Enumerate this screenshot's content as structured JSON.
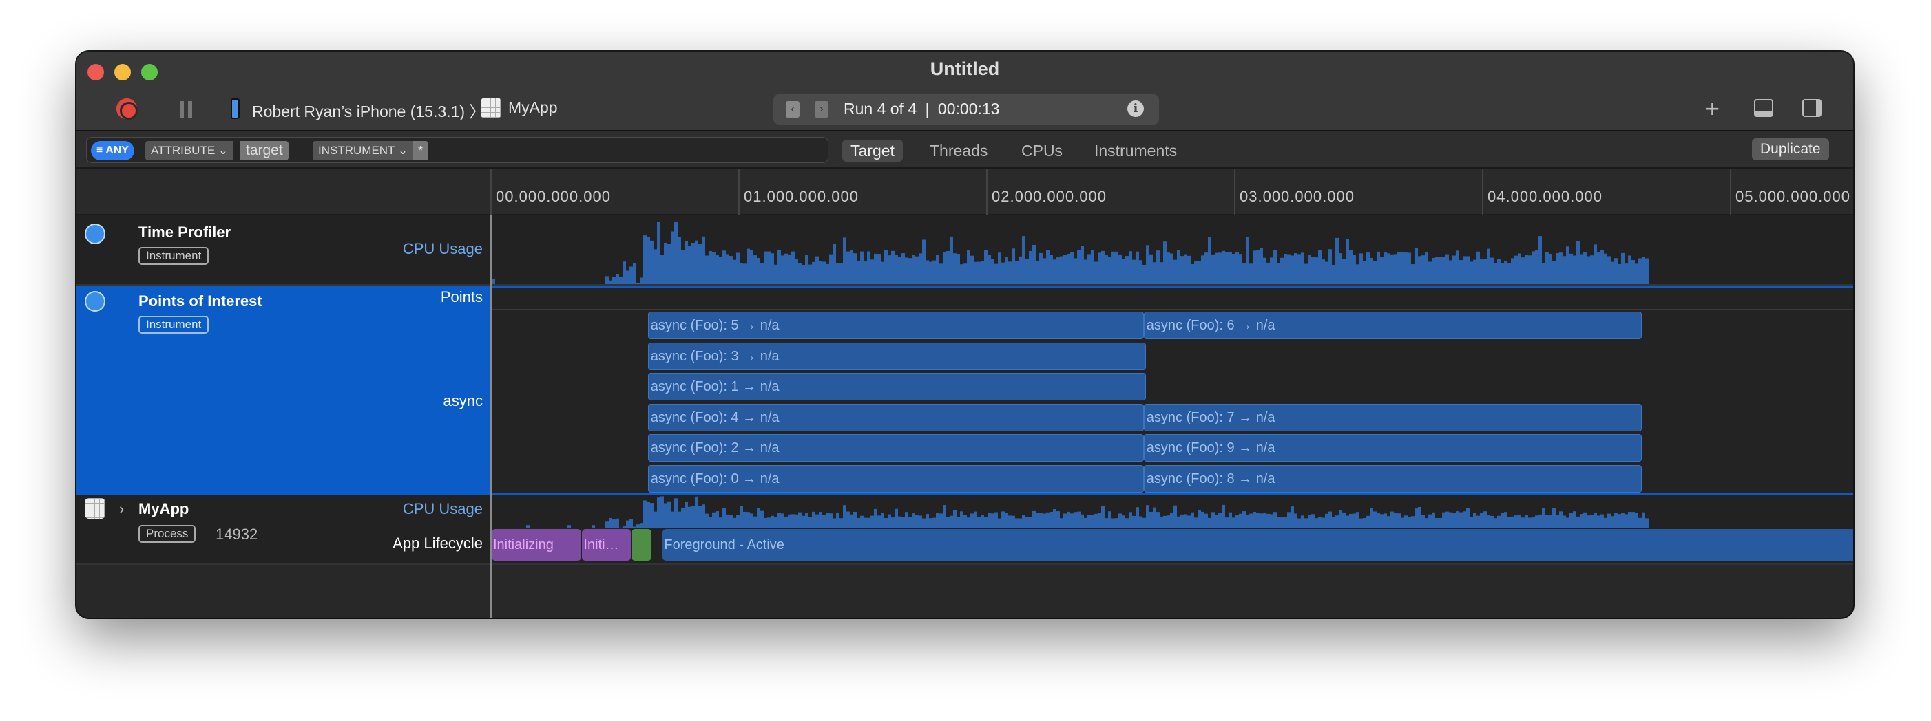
{
  "window": {
    "title": "Untitled"
  },
  "toolbar": {
    "device": "Robert Ryan’s iPhone (15.3.1)",
    "separator": "〉",
    "app": "MyApp",
    "run": "Run 4 of 4",
    "divider": "|",
    "elapsed": "00:00:13",
    "info": "i",
    "prev": "‹",
    "next": "›",
    "add": "+"
  },
  "filter": {
    "any": "ANY",
    "attribute": "ATTRIBUTE ⌄",
    "attribute_value": "target",
    "instrument": "INSTRUMENT ⌄",
    "instrument_value": "*"
  },
  "tabs": [
    "Target",
    "Threads",
    "CPUs",
    "Instruments"
  ],
  "duplicate": "Duplicate",
  "ruler": [
    "00.000.000.000",
    "01.000.000.000",
    "02.000.000.000",
    "03.000.000.000",
    "04.000.000.000",
    "05.000.000.000"
  ],
  "tracks": {
    "time_profiler": {
      "name": "Time Profiler",
      "badge": "Instrument",
      "lane": "CPU Usage"
    },
    "poi": {
      "name": "Points of Interest",
      "badge": "Instrument",
      "lane_points": "Points",
      "lane_async": "async"
    },
    "myapp": {
      "name": "MyApp",
      "badge": "Process",
      "pid": "14932",
      "lane_cpu": "CPU Usage",
      "lane_lifecycle": "App Lifecycle"
    }
  },
  "intervals": [
    {
      "label": "async (Foo): 5 → n/a",
      "row": 0,
      "start": 0.63,
      "end": 2.63
    },
    {
      "label": "async (Foo): 6 → n/a",
      "row": 0,
      "start": 2.63,
      "end": 4.64
    },
    {
      "label": "async (Foo): 3 → n/a",
      "row": 1,
      "start": 0.63,
      "end": 2.64
    },
    {
      "label": "async (Foo): 1 → n/a",
      "row": 2,
      "start": 0.63,
      "end": 2.64
    },
    {
      "label": "async (Foo): 4 → n/a",
      "row": 3,
      "start": 0.63,
      "end": 2.63
    },
    {
      "label": "async (Foo): 7 → n/a",
      "row": 3,
      "start": 2.63,
      "end": 4.64
    },
    {
      "label": "async (Foo): 2 → n/a",
      "row": 4,
      "start": 0.63,
      "end": 2.63
    },
    {
      "label": "async (Foo): 9 → n/a",
      "row": 4,
      "start": 2.63,
      "end": 4.64
    },
    {
      "label": "async (Foo): 0 → n/a",
      "row": 5,
      "start": 0.63,
      "end": 2.63
    },
    {
      "label": "async (Foo): 8 → n/a",
      "row": 5,
      "start": 2.63,
      "end": 4.64
    }
  ],
  "lifecycle": [
    {
      "label": "Initializing",
      "start": 0.0,
      "end": 0.36,
      "color": "#7e4ba3",
      "text": "#e7a6f5"
    },
    {
      "label": "Initi…",
      "start": 0.365,
      "end": 0.56,
      "color": "#7e4ba3",
      "text": "#e7a6f5"
    },
    {
      "label": "",
      "start": 0.565,
      "end": 0.645,
      "color": "#4e8f45",
      "text": "#fff"
    },
    {
      "label": "Foreground - Active",
      "start": 0.69,
      "end": 5.6,
      "color": "#275a9e",
      "text": "#9fc0ec"
    }
  ],
  "colors": {
    "selection": "#0b5cc7",
    "accent": "#3b8ee8",
    "cpu": "#2d64ab"
  }
}
